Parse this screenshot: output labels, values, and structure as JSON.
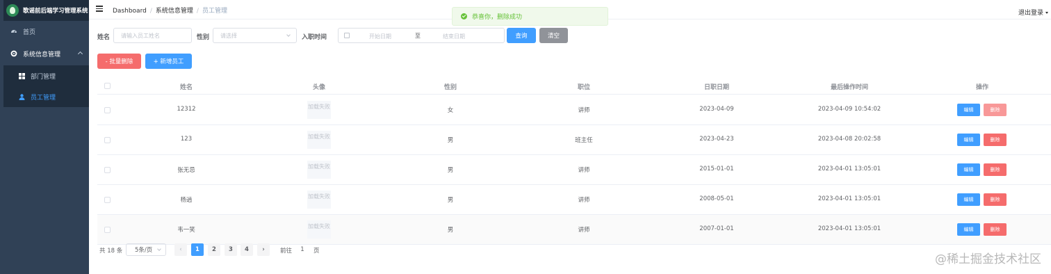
{
  "app": {
    "title": "歌谣前后端学习管理系统"
  },
  "sidebar": {
    "items": [
      {
        "label": "首页",
        "icon": "dashboard-icon"
      },
      {
        "label": "系统信息管理",
        "icon": "gear-icon",
        "expanded": true
      }
    ],
    "subitems": [
      {
        "label": "部门管理",
        "icon": "grid-icon",
        "active": false
      },
      {
        "label": "员工管理",
        "icon": "user-icon",
        "active": true
      }
    ]
  },
  "navbar": {
    "breadcrumb": [
      "Dashboard",
      "系统信息管理",
      "员工管理"
    ],
    "logout": "退出登录"
  },
  "toast": {
    "text": "恭喜你，删除成功",
    "color": "#67c23a"
  },
  "search": {
    "name_label": "姓名",
    "name_placeholder": "请输入员工姓名",
    "gender_label": "性别",
    "gender_placeholder": "请选择",
    "date_label": "入职时间",
    "start_placeholder": "开始日期",
    "range_sep": "至",
    "end_placeholder": "结束日期",
    "query": "查询",
    "clear": "清空"
  },
  "actions": {
    "batch_delete": "- 批量删除",
    "add": "+ 新增员工"
  },
  "table": {
    "headers": [
      "姓名",
      "头像",
      "性别",
      "职位",
      "日职日期",
      "最后操作时间",
      "操作"
    ],
    "rows": [
      {
        "name": "12312",
        "avatar": "加载失败",
        "gender": "女",
        "job": "讲师",
        "entry": "2023-04-09",
        "updated": "2023-04-09 10:54:02"
      },
      {
        "name": "123",
        "avatar": "加载失败",
        "gender": "男",
        "job": "班主任",
        "entry": "2023-04-23",
        "updated": "2023-04-08 20:02:58"
      },
      {
        "name": "张无忌",
        "avatar": "加载失败",
        "gender": "男",
        "job": "讲师",
        "entry": "2015-01-01",
        "updated": "2023-04-01 13:05:01"
      },
      {
        "name": "杨逍",
        "avatar": "加载失败",
        "gender": "男",
        "job": "讲师",
        "entry": "2008-05-01",
        "updated": "2023-04-01 13:05:01"
      },
      {
        "name": "韦一笑",
        "avatar": "加载失败",
        "gender": "男",
        "job": "讲师",
        "entry": "2007-01-01",
        "updated": "2023-04-01 13:05:01"
      }
    ],
    "edit_label": "编辑",
    "delete_label": "删除"
  },
  "pagination": {
    "total": "共 18 条",
    "page_size": "5条/页",
    "prev": "‹",
    "pages": [
      "1",
      "2",
      "3",
      "4"
    ],
    "current": "1",
    "next": "›",
    "goto_prefix": "前往",
    "goto_value": "1",
    "goto_suffix": "页"
  },
  "watermark": "@稀土掘金技术社区",
  "colors": {
    "sidebar": "#304156",
    "primary": "#409eff",
    "danger": "#f56c6c",
    "info": "#909399"
  }
}
